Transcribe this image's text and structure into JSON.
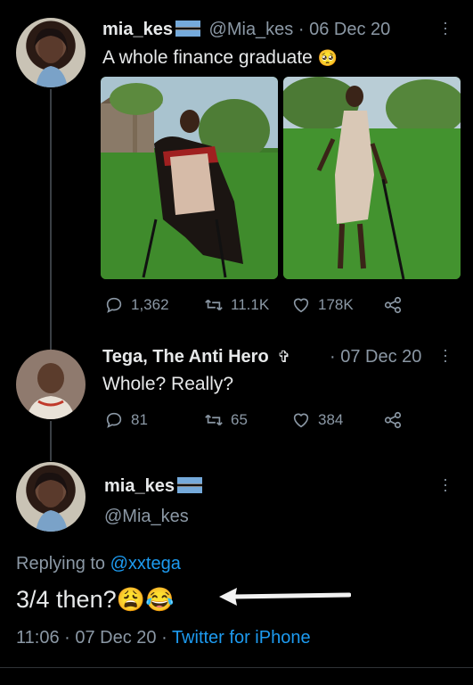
{
  "tweet1": {
    "name": "mia_kes",
    "handle_date": "@Mia_kes · 06 Dec 20",
    "text": "A whole finance graduate",
    "emoji": "🥺",
    "replies": "1,362",
    "retweets": "11.1K",
    "likes": "178K"
  },
  "tweet2": {
    "name": "Tega, The Anti Hero",
    "name_glyph": "✞",
    "date": "· 07 Dec 20",
    "text": "Whole? Really?",
    "replies": "81",
    "retweets": "65",
    "likes": "384"
  },
  "tweet3": {
    "name": "mia_kes",
    "handle": "@Mia_kes",
    "replying_prefix": "Replying to",
    "replying_handle": "@xxtega",
    "text": "3/4 then?",
    "emojis": "😩😂",
    "timestamp": "11:06 · 07 Dec 20 ·",
    "source": "Twitter for iPhone"
  },
  "colors": {
    "background": "#000000",
    "text": "#e7e9ea",
    "muted": "#8b98a5",
    "link": "#1d9bf0",
    "flag_blue": "#75aadb"
  },
  "icons": [
    "reply-icon",
    "retweet-icon",
    "like-icon",
    "share-icon",
    "more-icon",
    "arrow-icon"
  ]
}
